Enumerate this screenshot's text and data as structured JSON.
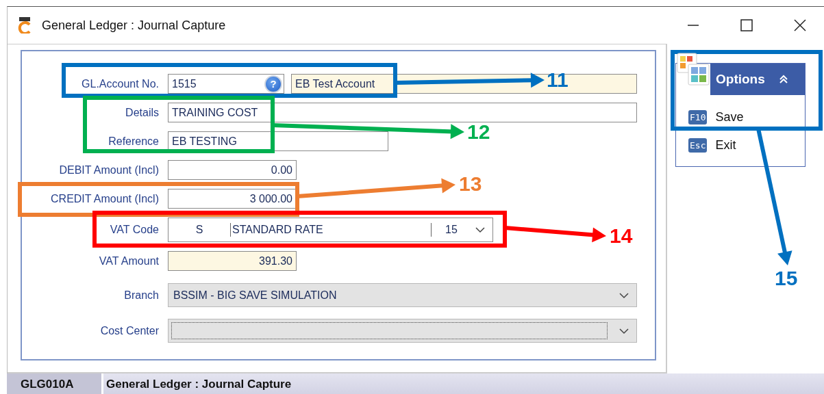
{
  "window": {
    "title": "General Ledger : Journal Capture"
  },
  "form": {
    "fields": [
      {
        "kind": "lookup",
        "label": "GL.Account No.",
        "value": "1515",
        "help": "?",
        "description": "EB Test Account"
      },
      {
        "kind": "text",
        "label": "Details",
        "value": "TRAINING COST"
      },
      {
        "kind": "text",
        "label": "Reference",
        "value": "EB TESTING"
      },
      {
        "kind": "amount",
        "label": "DEBIT Amount (Incl)",
        "value": "0.00"
      },
      {
        "kind": "amount",
        "label": "CREDIT Amount (Incl)",
        "value": "3 000.00"
      },
      {
        "kind": "vat",
        "label": "VAT Code",
        "code": "S",
        "description": "STANDARD RATE",
        "rate": "15"
      },
      {
        "kind": "readonly_amount",
        "label": "VAT Amount",
        "value": "391.30"
      },
      {
        "kind": "dropdown",
        "label": "Branch",
        "value": "BSSIM - BIG SAVE SIMULATION",
        "focused": false
      },
      {
        "kind": "dropdown",
        "label": "Cost Center",
        "focused": true
      }
    ]
  },
  "options": {
    "title": "Options",
    "expanded": true,
    "items": [
      {
        "key": "F10",
        "label": "Save"
      },
      {
        "key": "Esc",
        "label": "Exit"
      }
    ]
  },
  "status_bar": {
    "code": "GLG010A",
    "text": "General Ledger : Journal Capture"
  },
  "annotations": [
    {
      "label": "11",
      "color": "#0070c0"
    },
    {
      "label": "12",
      "color": "#00b050"
    },
    {
      "label": "13",
      "color": "#ed7d31"
    },
    {
      "label": "14",
      "color": "#ff0000"
    },
    {
      "label": "15",
      "color": "#0070c0"
    }
  ]
}
